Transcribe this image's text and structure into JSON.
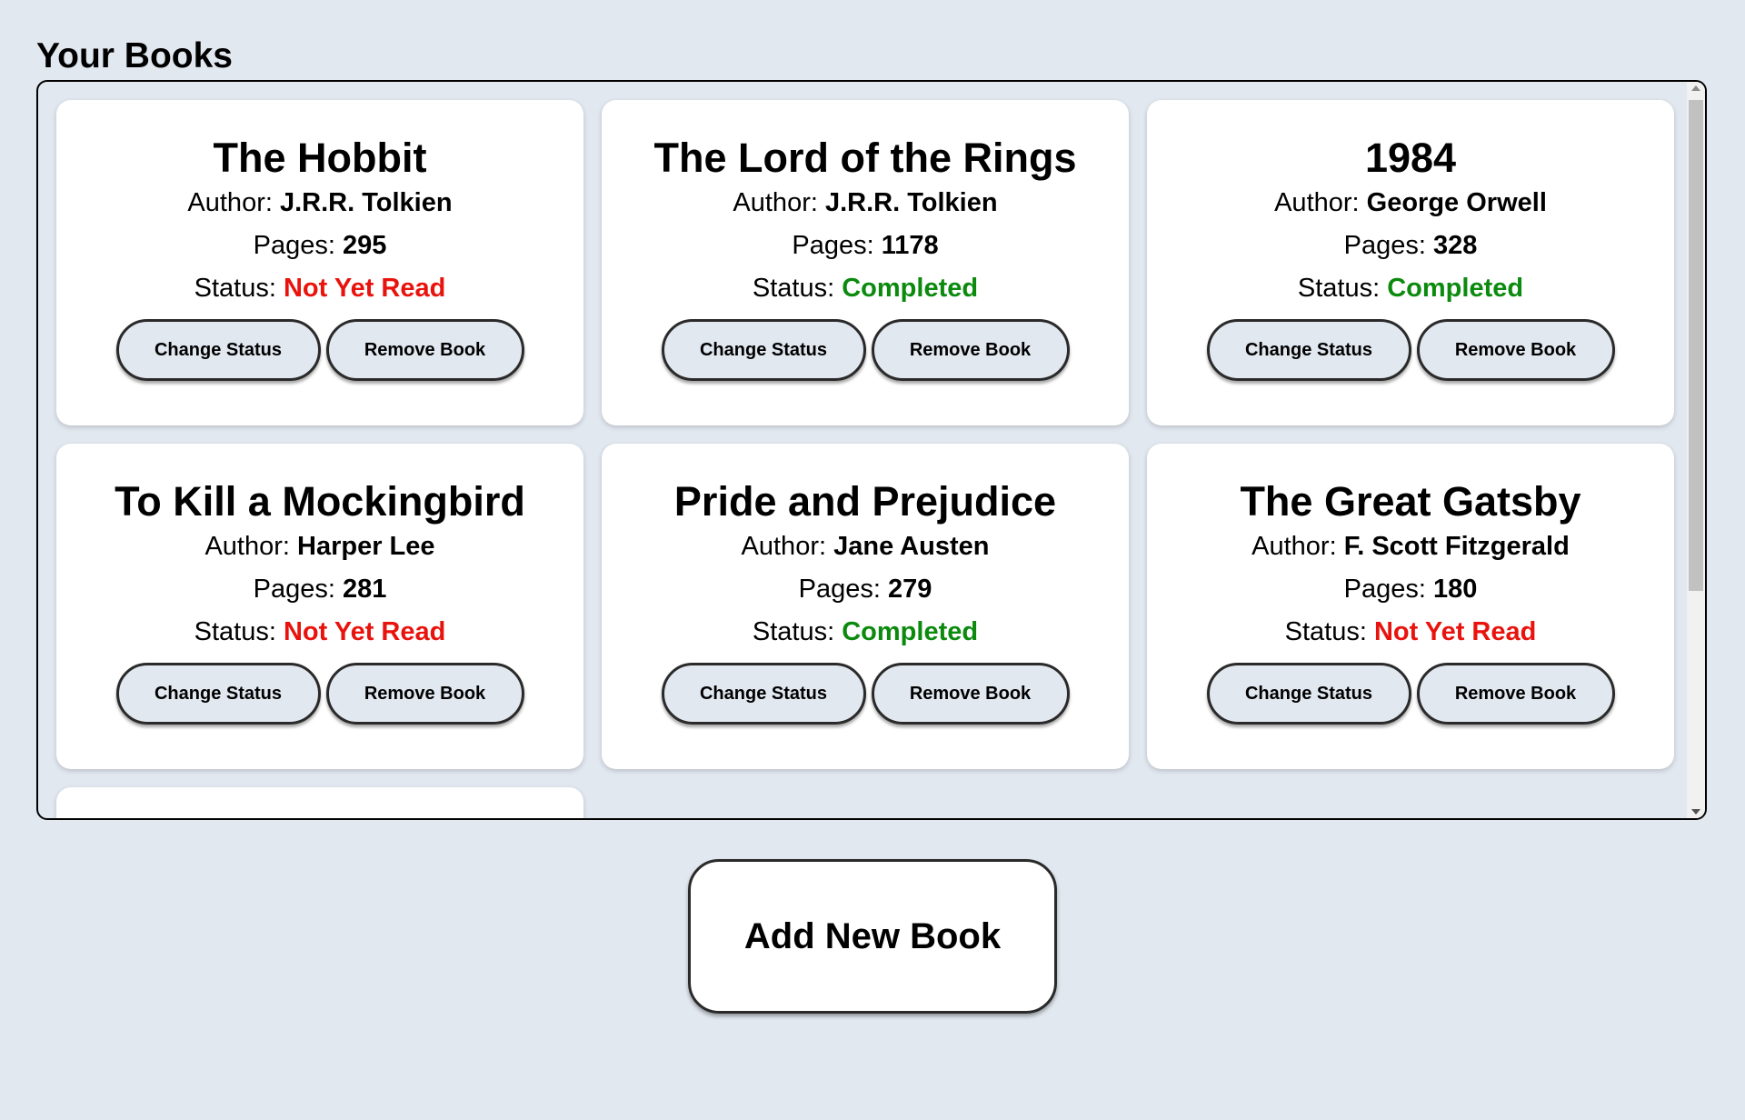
{
  "page": {
    "title": "Your Books"
  },
  "labels": {
    "author": "Author: ",
    "pages": "Pages: ",
    "status": "Status: ",
    "change_status": "Change Status",
    "remove_book": "Remove Book"
  },
  "books": [
    {
      "title": "The Hobbit",
      "author": "J.R.R. Tolkien",
      "pages": "295",
      "status": "Not Yet Read"
    },
    {
      "title": "The Lord of the Rings",
      "author": "J.R.R. Tolkien",
      "pages": "1178",
      "status": "Completed"
    },
    {
      "title": "1984",
      "author": "George Orwell",
      "pages": "328",
      "status": "Completed"
    },
    {
      "title": "To Kill a Mockingbird",
      "author": "Harper Lee",
      "pages": "281",
      "status": "Not Yet Read"
    },
    {
      "title": "Pride and Prejudice",
      "author": "Jane Austen",
      "pages": "279",
      "status": "Completed"
    },
    {
      "title": "The Great Gatsby",
      "author": "F. Scott Fitzgerald",
      "pages": "180",
      "status": "Not Yet Read"
    }
  ],
  "add_button": {
    "label": "Add New Book"
  },
  "colors": {
    "not_read": "#e8130d",
    "completed": "#0b8a0e",
    "background": "#e2e8f0"
  }
}
